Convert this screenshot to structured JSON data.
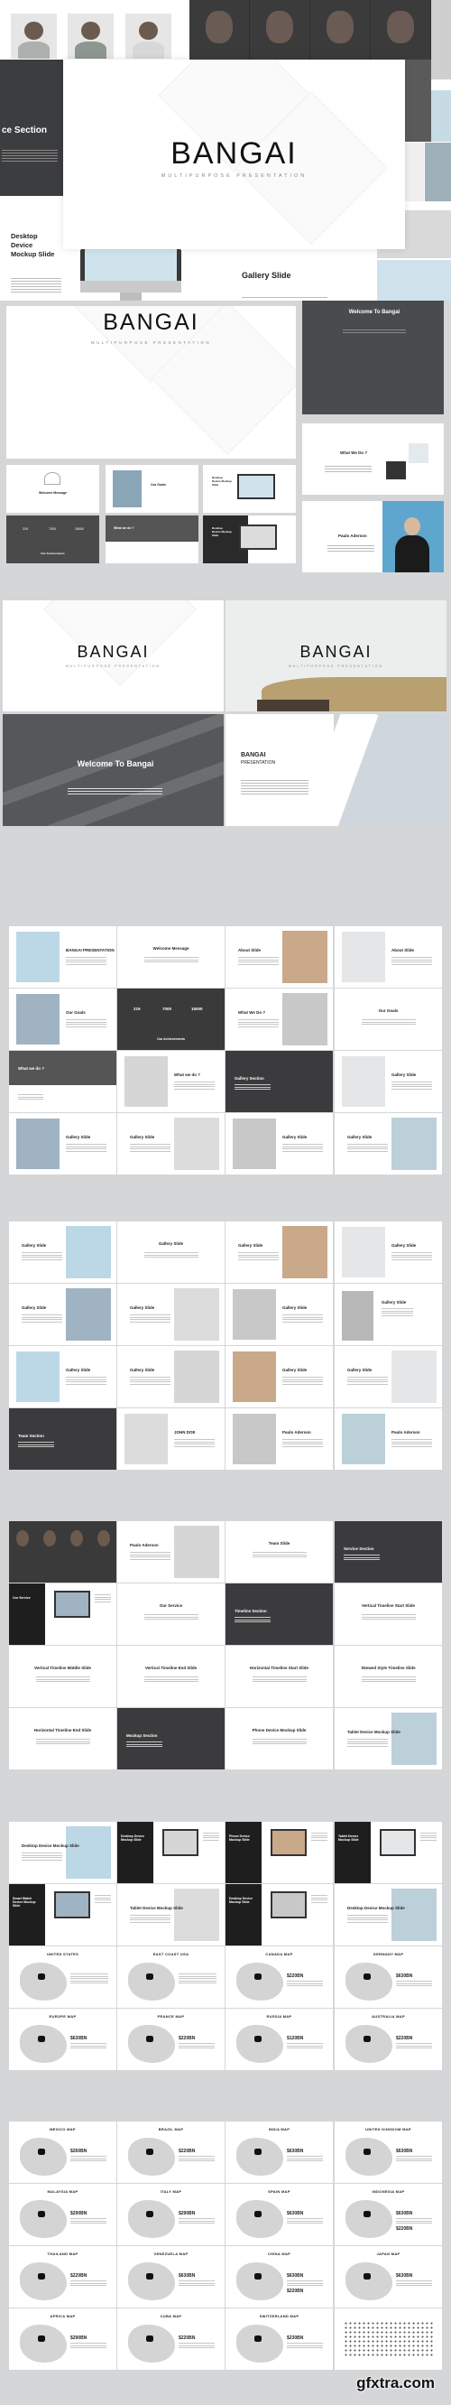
{
  "hero": {
    "brand": "BANGAI",
    "tagline": "MULTIPURPOSE PRESENTATION"
  },
  "collage": {
    "section_title": "ce Section",
    "desktop_title": "Desktop Device Mockup Slide",
    "gallery_title": "Gallery Slide"
  },
  "featured": {
    "main_brand": "BANGAI",
    "main_tagline": "MULTIPURPOSE PRESENTATION",
    "welcome_title": "Welcome To Bangai",
    "what_title": "What We Do ?",
    "person_name": "Paulo Aderson",
    "small_slides": [
      "Welcome Message",
      "Our Goals",
      "Desktop Device Mockup Slide",
      "Our Achievements",
      "What we do ?",
      "Desktop Device Mockup Slide"
    ],
    "small_stats": [
      "219",
      "7000",
      "15000"
    ]
  },
  "showcase": {
    "slide1_brand": "BANGAI",
    "slide1_tagline": "MULTIPURPOSE PRESENTATION",
    "slide2_brand": "BANGAI",
    "slide2_tagline": "MULTIPURPOSE PRESENTATION",
    "slide3_title": "Welcome To Bangai",
    "slide4_title": "BANGAI",
    "slide4_subtitle": "PRESENTATION"
  },
  "colors": {
    "background": "#d5d6d8",
    "dark_slide": "#3a3a3a",
    "accent_sky": "#bcd8e6",
    "map_gray": "#d4d4d4"
  },
  "grids": [
    {
      "slides": [
        {
          "title": "BANGAI PRESENTATION"
        },
        {
          "title": "Welcome Message"
        },
        {
          "title": "About Slide"
        },
        {
          "title": "About Slide"
        },
        {
          "title": "Our Goals"
        },
        {
          "title": "Our Achievements",
          "stats": [
            "219",
            "7000",
            "15000"
          ]
        },
        {
          "title": "What We Do ?"
        },
        {
          "title": "Our Goals"
        },
        {
          "title": "What we do ?"
        },
        {
          "title": "What we do ?"
        },
        {
          "title": "Gallery Section"
        },
        {
          "title": "Gallery Slide"
        },
        {
          "title": "Gallery Slide"
        },
        {
          "title": "Gallery Slide"
        },
        {
          "title": "Gallery Slide"
        },
        {
          "title": "Gallery Slide"
        }
      ]
    },
    {
      "slides": [
        {
          "title": "Gallery Slide"
        },
        {
          "title": "Gallery Slide"
        },
        {
          "title": "Gallery Slide"
        },
        {
          "title": "Gallery Slide"
        },
        {
          "title": "Gallery Slide"
        },
        {
          "title": "Gallery Slide"
        },
        {
          "title": "Gallery Slide"
        },
        {
          "title": "Gallery Slide"
        },
        {
          "title": "Gallery Slide"
        },
        {
          "title": "Gallery Slide"
        },
        {
          "title": "Gallery Slide"
        },
        {
          "title": "Gallery Slide"
        },
        {
          "title": "Team Section"
        },
        {
          "title": "JOHN DOE"
        },
        {
          "title": "Paulo Aderson"
        },
        {
          "title": "Paulo Aderson"
        }
      ]
    },
    {
      "slides": [
        {
          "title": ""
        },
        {
          "title": "Paulo Aderson"
        },
        {
          "title": "Team Slide"
        },
        {
          "title": "Service Section"
        },
        {
          "title": "Our Service"
        },
        {
          "title": "Our Service"
        },
        {
          "title": "Timeline Section"
        },
        {
          "title": "Vertical Timeline Start Slide"
        },
        {
          "title": "Vertical Timeline Middle Slide"
        },
        {
          "title": "Vertical Timeline End Slide"
        },
        {
          "title": "Horizontal Timeline Start Slide"
        },
        {
          "title": "Skewed Style Timeline Slide"
        },
        {
          "title": "Horizontal Timeline End Slide"
        },
        {
          "title": "Mockup Section"
        },
        {
          "title": "Phone Device Mockup Slide"
        },
        {
          "title": "Tablet Device Mockup Slide"
        }
      ]
    },
    {
      "slides": [
        {
          "title": "Desktop Device Mockup Slide"
        },
        {
          "title": "Desktop Device Mockup Slide"
        },
        {
          "title": "Phone Device Mockup Slide"
        },
        {
          "title": "Tablet Device Mockup Slide"
        },
        {
          "title": "Smart Watch Device Mockup Slide"
        },
        {
          "title": "Tablet Device Mockup Slide"
        },
        {
          "title": "Desktop Device Mockup Slide"
        },
        {
          "title": "Desktop Device Mockup Slide"
        },
        {
          "title": "UNITED STATES"
        },
        {
          "title": "EAST COAST USA"
        },
        {
          "title": "CANADA MAP",
          "value": "$220BN"
        },
        {
          "title": "GERMANY MAP",
          "value": "$630BN"
        },
        {
          "title": "EUROPE MAP",
          "value": "$630BN"
        },
        {
          "title": "FRANCE MAP",
          "value": "$220BN"
        },
        {
          "title": "RUSSIA MAP",
          "value": "$120BN"
        },
        {
          "title": "AUSTRALIA MAP",
          "value": "$220BN"
        }
      ]
    },
    {
      "slides": [
        {
          "title": "MEXICO MAP",
          "value": "$260BN"
        },
        {
          "title": "BRAZIL MAP",
          "value": "$220BN"
        },
        {
          "title": "INDIA MAP",
          "value": "$630BN"
        },
        {
          "title": "UNITED KINGDOM MAP",
          "value": "$630BN"
        },
        {
          "title": "MALAYSIA MAP",
          "value": "$290BN"
        },
        {
          "title": "ITALY MAP",
          "value": "$290BN"
        },
        {
          "title": "SPAIN MAP",
          "value": "$630BN"
        },
        {
          "title": "INDONESIA MAP",
          "value": "$630BN",
          "value2": "$220BN"
        },
        {
          "title": "THAILAND MAP",
          "value": "$220BN"
        },
        {
          "title": "VENEZUELA MAP",
          "value": "$630BN"
        },
        {
          "title": "CHINA MAP",
          "value": "$630BN",
          "value2": "$220BN"
        },
        {
          "title": "JAPAN MAP",
          "value": "$630BN"
        },
        {
          "title": "AFRICA MAP",
          "value": "$290BN"
        },
        {
          "title": "CUBA MAP",
          "value": "$220BN"
        },
        {
          "title": "SWITZERLAND MAP",
          "value": "$230BN"
        },
        {
          "title": ""
        }
      ]
    }
  ],
  "watermark": "gfxtra.com"
}
